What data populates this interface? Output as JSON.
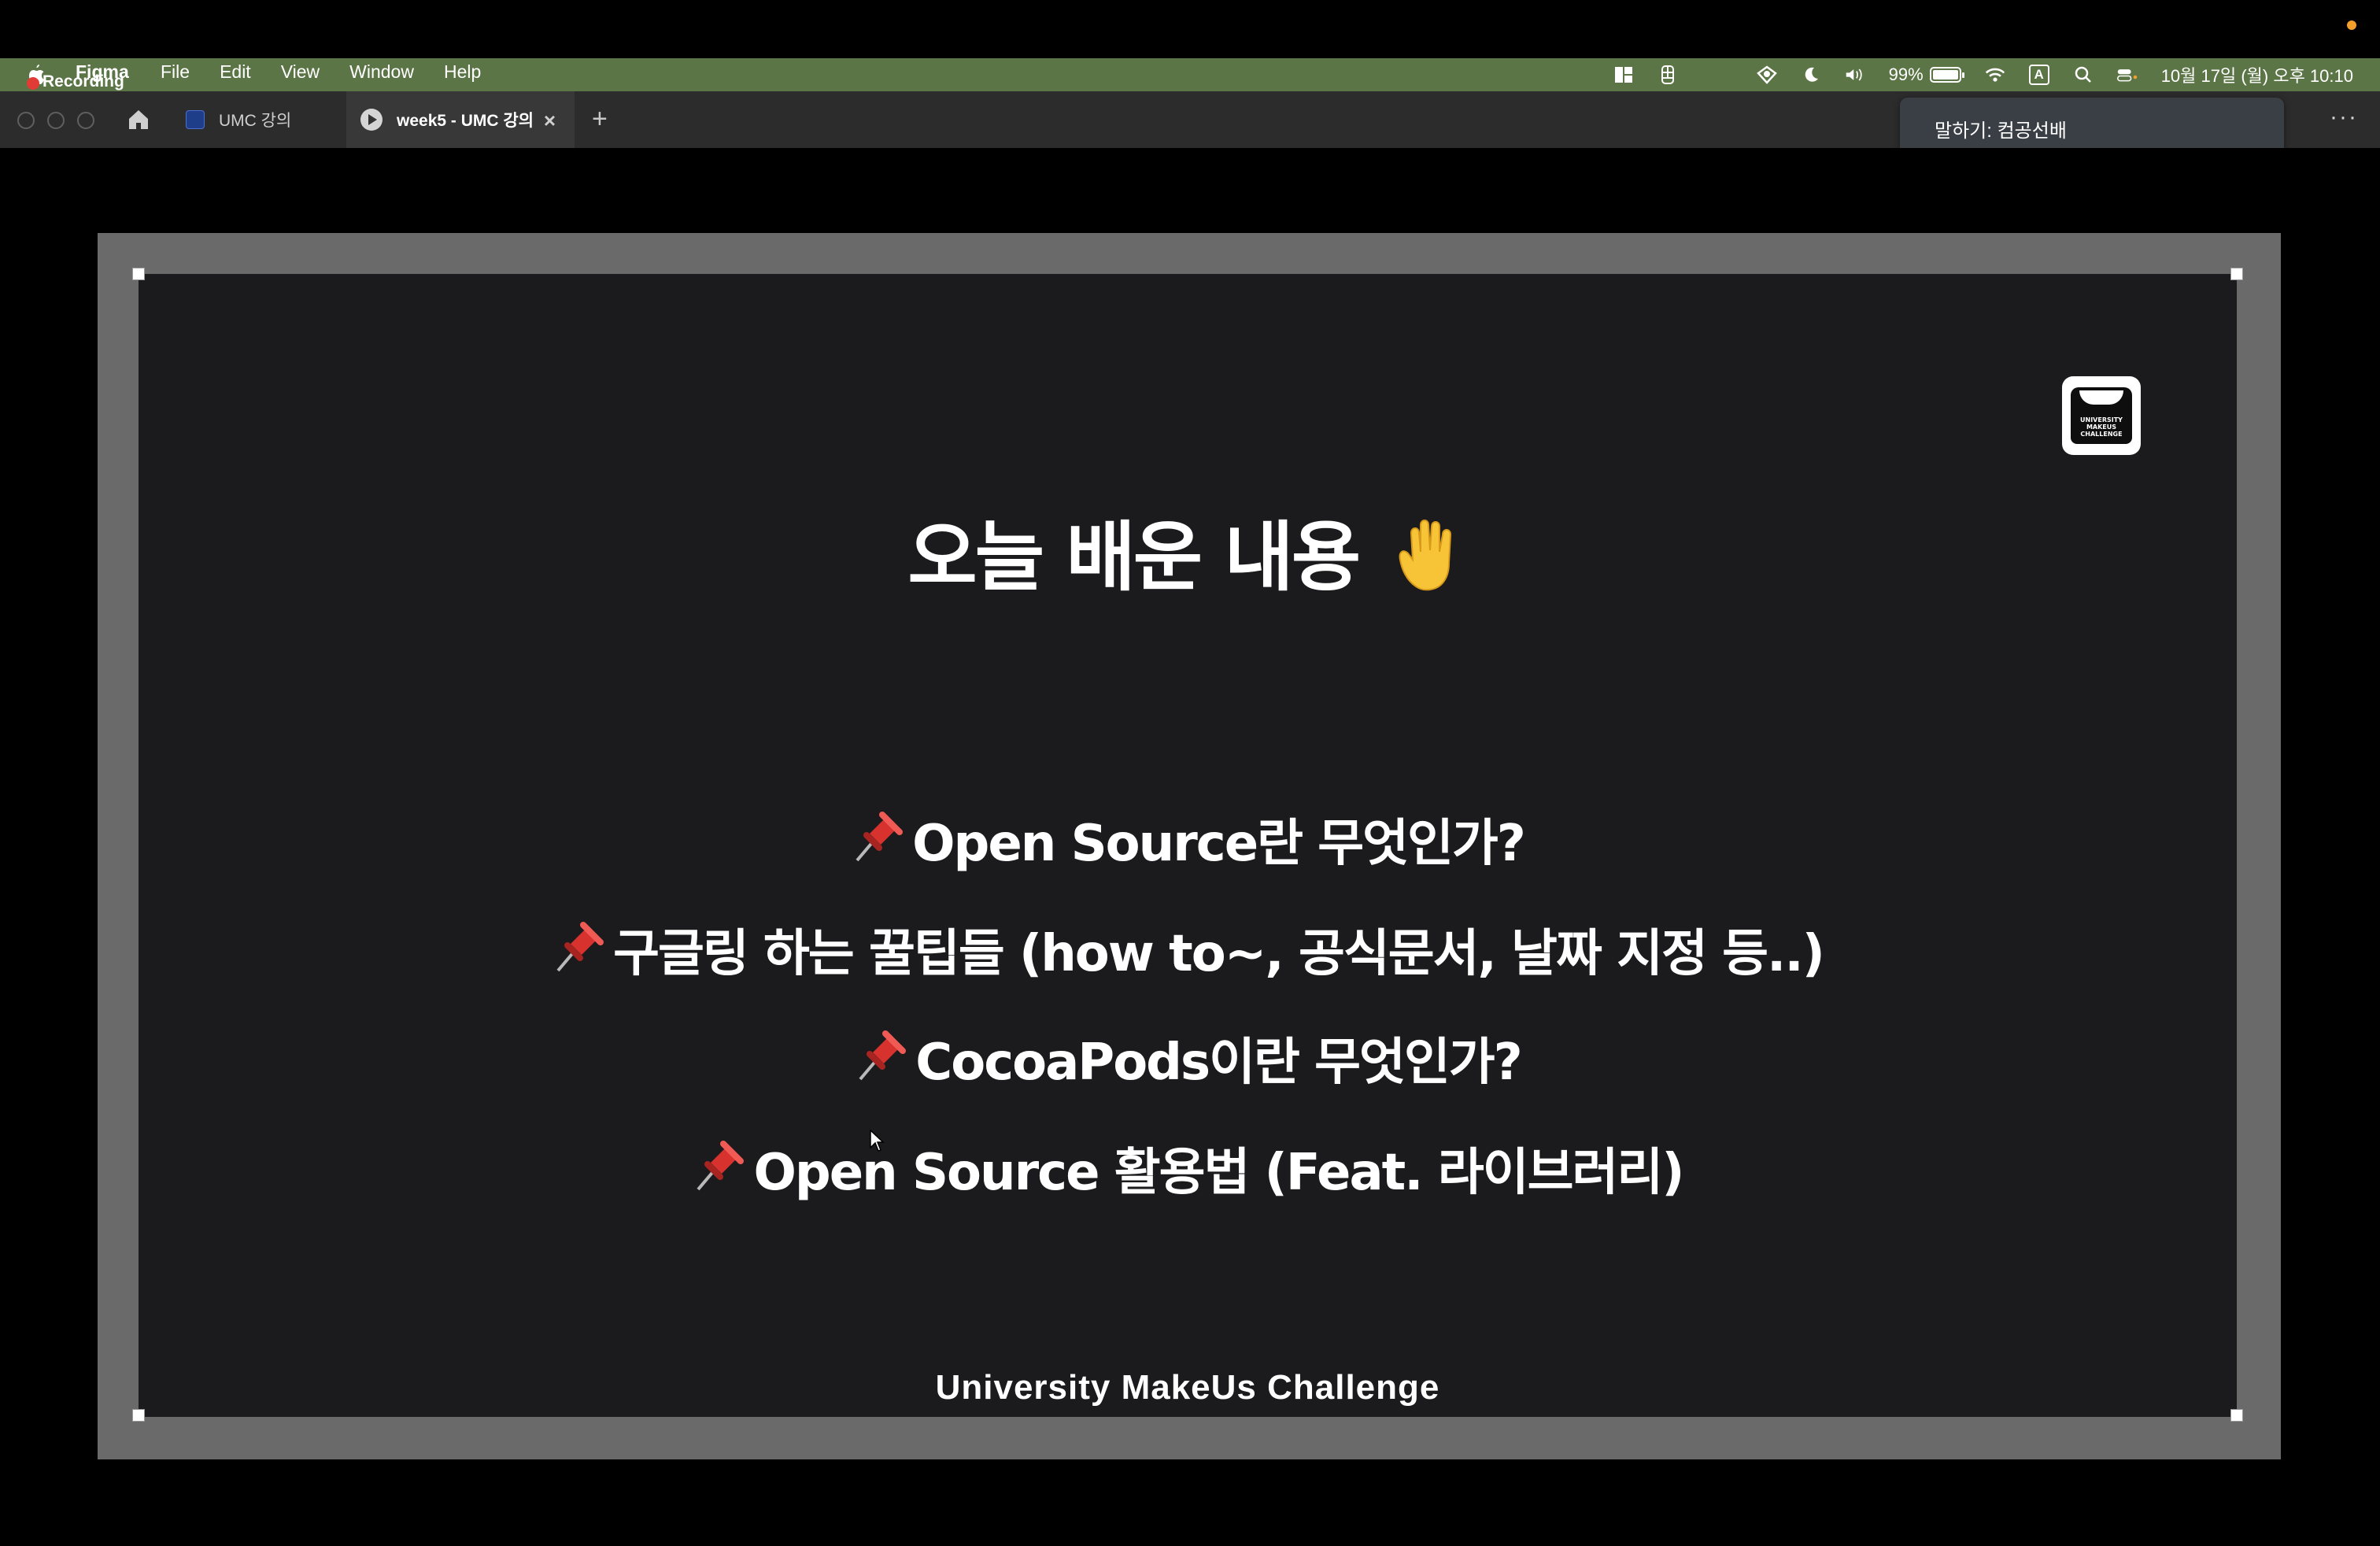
{
  "menubar": {
    "recording_label": "Recording",
    "app_name": "Figma",
    "menus": [
      "File",
      "Edit",
      "View",
      "Window",
      "Help"
    ],
    "battery_percent": "99%",
    "battery_level": 0.99,
    "input_source": "A",
    "datetime": "10월 17일 (월) 오후 10:10",
    "icons": [
      "layout-icon",
      "figma-icon",
      "location-icon",
      "moon-icon",
      "volume-icon",
      "battery-icon",
      "wifi-icon",
      "input-source-icon",
      "search-icon",
      "control-center-icon"
    ]
  },
  "tabbar": {
    "tabs": [
      {
        "label": "UMC 강의",
        "active": false
      },
      {
        "label": "week5 - UMC 강의",
        "active": true
      }
    ],
    "close_glyph": "×",
    "add_glyph": "+",
    "more_glyph": "···"
  },
  "toast": {
    "text": "말하기: 컴공선배"
  },
  "slide": {
    "title": "오늘 배운 내용",
    "title_emoji": "✋",
    "bullets": [
      "Open Source란 무엇인가?",
      "구글링 하는 꿀팁들 (how to~, 공식문서, 날짜 지정 등..)",
      "CocoaPods이란 무엇인가?",
      "Open Source 활용법 (Feat. 라이브러리)"
    ],
    "logo_text": "UNIVERSITY MAKEUS CHALLENGE",
    "footer": "University MakeUs Challenge"
  },
  "colors": {
    "menubar_bg": "#5b7546",
    "tabbar_bg": "#2c2c2c",
    "slide_bg": "#1b1b1d",
    "frame_bg": "#6a6a6a",
    "pin_red": "#d8322f",
    "toast_bg": "#3a3f45"
  }
}
